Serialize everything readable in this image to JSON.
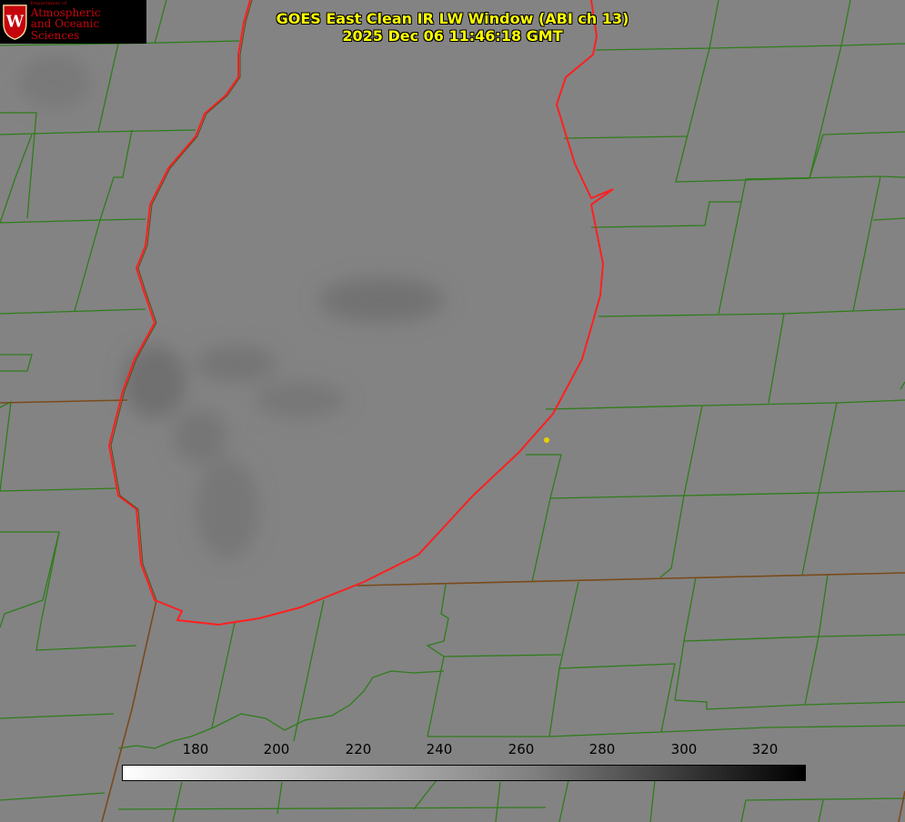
{
  "header": {
    "title_line1": "GOES East Clean IR LW Window (ABI ch 13)",
    "title_line2": "2025 Dec 06 11:46:18 GMT"
  },
  "logo": {
    "department": "Department of",
    "name_line1": "Atmospheric",
    "name_line2": "and Oceanic Sciences"
  },
  "colorbar": {
    "ticks": [
      "180",
      "200",
      "220",
      "240",
      "260",
      "280",
      "300",
      "320"
    ]
  },
  "colors": {
    "background_gray": "#808080",
    "county_lines": "#2e7d1a",
    "state_lines": "#7a4a1a",
    "lake_outline": "#ff2020",
    "title": "#ffff00",
    "point_marker": "#e6d200"
  }
}
